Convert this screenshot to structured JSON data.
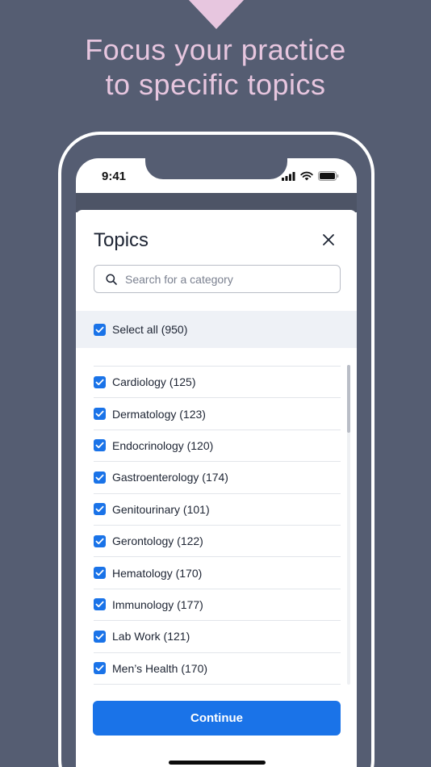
{
  "promo": {
    "headline_line1": "Focus your practice",
    "headline_line2": "to specific topics"
  },
  "status_bar": {
    "time": "9:41",
    "icons": [
      "cellular-signal-icon",
      "wifi-icon",
      "battery-icon"
    ]
  },
  "sheet": {
    "title": "Topics",
    "close_icon": "close-icon",
    "search": {
      "placeholder": "Search for a category",
      "value": "",
      "icon": "search-icon"
    },
    "select_all": {
      "label": "Select all (950)",
      "checked": true
    },
    "topics": [
      {
        "label": "Cardiology (125)",
        "checked": true
      },
      {
        "label": "Dermatology (123)",
        "checked": true
      },
      {
        "label": "Endocrinology (120)",
        "checked": true
      },
      {
        "label": "Gastroenterology (174)",
        "checked": true
      },
      {
        "label": "Genitourinary (101)",
        "checked": true
      },
      {
        "label": "Gerontology (122)",
        "checked": true
      },
      {
        "label": "Hematology (170)",
        "checked": true
      },
      {
        "label": "Immunology (177)",
        "checked": true
      },
      {
        "label": "Lab Work (121)",
        "checked": true
      },
      {
        "label": "Men’s Health (170)",
        "checked": true
      }
    ],
    "continue_label": "Continue"
  },
  "colors": {
    "background": "#555d72",
    "headline": "#e7c6df",
    "accent": "#1a73e8",
    "select_all_bg": "#eef1f6"
  }
}
